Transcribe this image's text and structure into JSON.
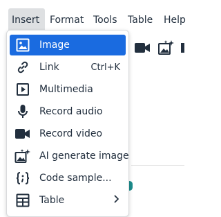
{
  "menubar": {
    "items": [
      {
        "label": "Insert",
        "active": true
      },
      {
        "label": "Format"
      },
      {
        "label": "Tools"
      },
      {
        "label": "Table"
      },
      {
        "label": "Help"
      }
    ]
  },
  "menu": {
    "items": [
      {
        "icon": "image-icon",
        "label": "Image",
        "selected": true
      },
      {
        "icon": "link-icon",
        "label": "Link",
        "shortcut": "Ctrl+K"
      },
      {
        "icon": "multimedia-icon",
        "label": "Multimedia"
      },
      {
        "icon": "microphone-icon",
        "label": "Record audio"
      },
      {
        "icon": "video-camera-icon",
        "label": "Record video"
      },
      {
        "icon": "ai-image-icon",
        "label": "AI generate image"
      },
      {
        "icon": "code-sample-icon",
        "label": "Code sample..."
      },
      {
        "icon": "table-icon",
        "label": "Table",
        "submenu": true
      }
    ]
  },
  "colors": {
    "selected_bg": "#1a6be0",
    "menubar_active_bg": "#dee0e2",
    "text": "#222f3e"
  }
}
